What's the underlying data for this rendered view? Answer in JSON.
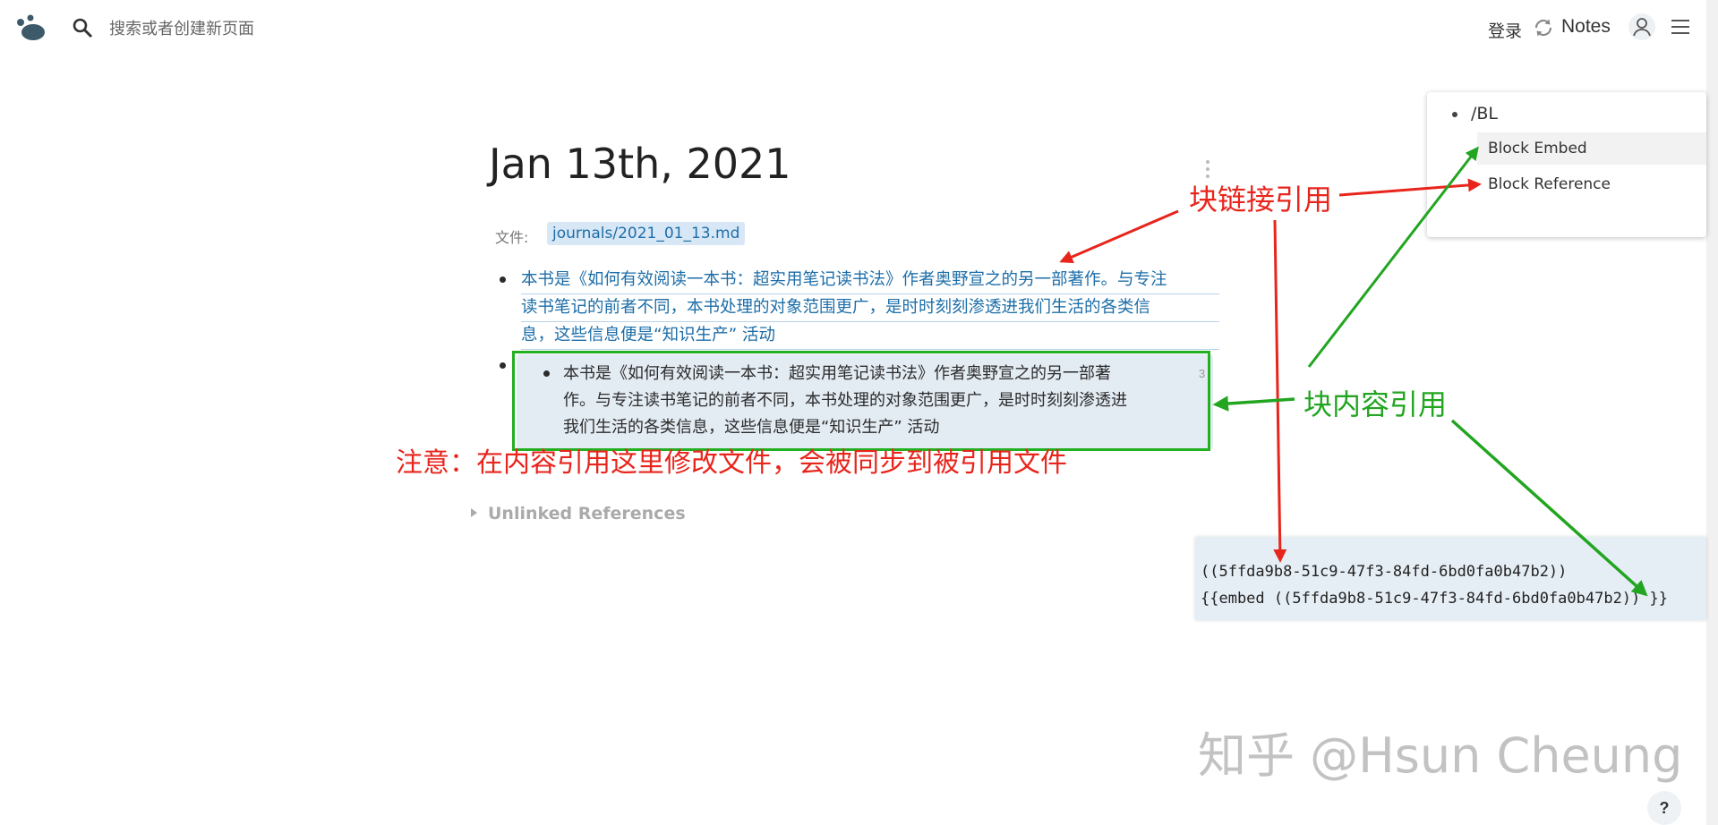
{
  "header": {
    "search_placeholder": "搜索或者创建新页面",
    "login_label": "登录",
    "notes_label": "Notes",
    "icons": [
      "logo-icon",
      "search-icon",
      "sync-icon",
      "avatar-icon",
      "menu-icon"
    ]
  },
  "page": {
    "title": "Jan 13th, 2021",
    "file_label": "文件:",
    "file_path": "journals/2021_01_13.md"
  },
  "blocks": {
    "reference_lines": [
      "本书是《如何有效阅读一本书：超实用笔记读书法》作者奥野宣之的另一部著作。与专注",
      "读书笔记的前者不同，本书处理的对象范围更广，是时时刻刻渗透进我们生活的各类信",
      "息，这些信息便是“知识生产” 活动"
    ],
    "embed_lines": [
      "本书是《如何有效阅读一本书：超实用笔记读书法》作者奥野宣之的另一部著",
      "作。与专注读书笔记的前者不同，本书处理的对象范围更广，是时时刻刻渗透进",
      "我们生活的各类信息，这些信息便是“知识生产” 活动"
    ],
    "embed_ref_count": "3"
  },
  "unlinked_references": "Unlinked References",
  "popup": {
    "input": "/BL",
    "items": [
      "Block Embed",
      "Block Reference"
    ]
  },
  "code": {
    "line1": "((5ffda9b8-51c9-47f3-84fd-6bd0fa0b47b2))",
    "line2": "{{embed ((5ffda9b8-51c9-47f3-84fd-6bd0fa0b47b2)) }}"
  },
  "annotations": {
    "block_link": "块链接引用",
    "block_content": "块内容引用",
    "note": "注意：在内容引用这里修改文件，会被同步到被引用文件"
  },
  "watermark": "知乎 @Hsun Cheung",
  "help_label": "?",
  "colors": {
    "annotation_red": "#e8251c",
    "annotation_green": "#22a521",
    "link_blue": "#1d6ea8",
    "embed_bg": "#e3ebf3"
  }
}
